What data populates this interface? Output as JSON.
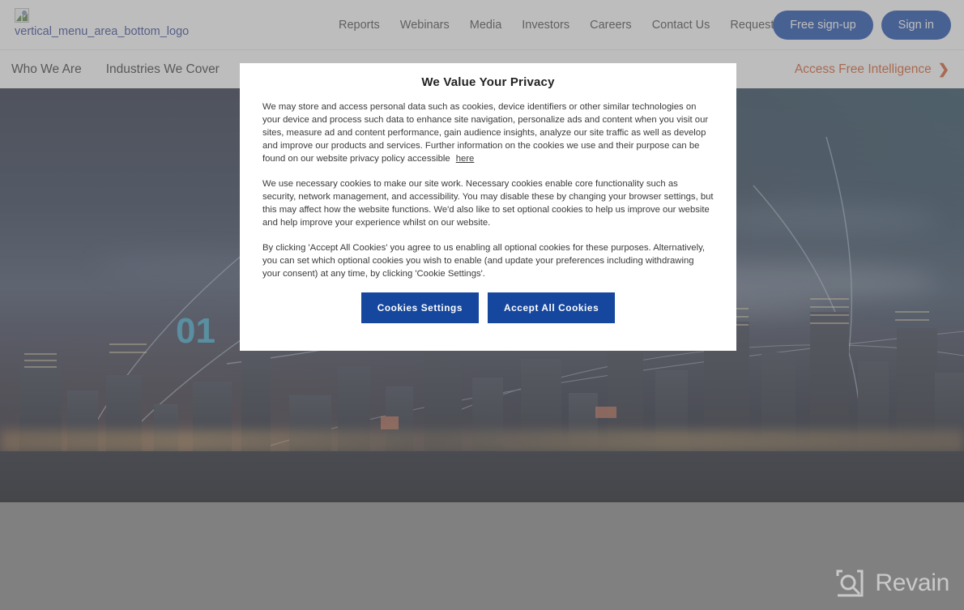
{
  "header": {
    "logo_alt": "vertical_menu_area_bottom_logo",
    "logo_icon": "broken-image-icon",
    "nav": [
      {
        "label": "Reports"
      },
      {
        "label": "Webinars"
      },
      {
        "label": "Media"
      },
      {
        "label": "Investors"
      },
      {
        "label": "Careers"
      },
      {
        "label": "Contact Us"
      },
      {
        "label": "Request a Demo"
      }
    ],
    "actions": {
      "signup_label": "Free sign-up",
      "signin_label": "Sign in",
      "button_color": "#0b3fa8"
    }
  },
  "subnav": {
    "items": [
      {
        "label": "Who We Are"
      },
      {
        "label": "Industries We Cover"
      }
    ],
    "cta": {
      "label": "Access Free Intelligence",
      "chevron": "❯",
      "color": "#d4521f"
    }
  },
  "hero": {
    "slide_number": "01",
    "slide_number_color": "#2f9fc4",
    "image_description": "night city skyline with waterfront and glowing network arcs"
  },
  "modal": {
    "title": "We Value Your Privacy",
    "paragraph_1_before_link": "We may store and access personal data such as cookies, device identifiers or other similar technologies on your device and process such data to enhance site navigation, personalize ads and content when you visit our sites, measure ad and content performance, gain audience insights, analyze our site traffic as well as develop and improve our products and services. Further information on the cookies we use and their purpose can be found on our website privacy policy accessible",
    "paragraph_1_link": "here",
    "paragraph_2": "We use necessary cookies to make our site work. Necessary cookies enable core functionality such as security, network management, and accessibility. You may disable these by changing your browser settings, but this may affect how the website functions. We'd also like to set optional cookies to help us improve our website and help improve your experience whilst on our website.",
    "paragraph_3": "By clicking 'Accept All Cookies' you agree to us enabling all optional cookies for these purposes. Alternatively, you can set which optional cookies you wish to enable (and update your preferences including withdrawing your consent) at any time, by clicking 'Cookie Settings'.",
    "buttons": {
      "settings_label": "Cookies Settings",
      "accept_label": "Accept All Cookies",
      "color": "#15479e"
    }
  },
  "watermark": {
    "label": "Revain",
    "icon": "revain-logo-icon",
    "color": "#c9c9c9"
  }
}
